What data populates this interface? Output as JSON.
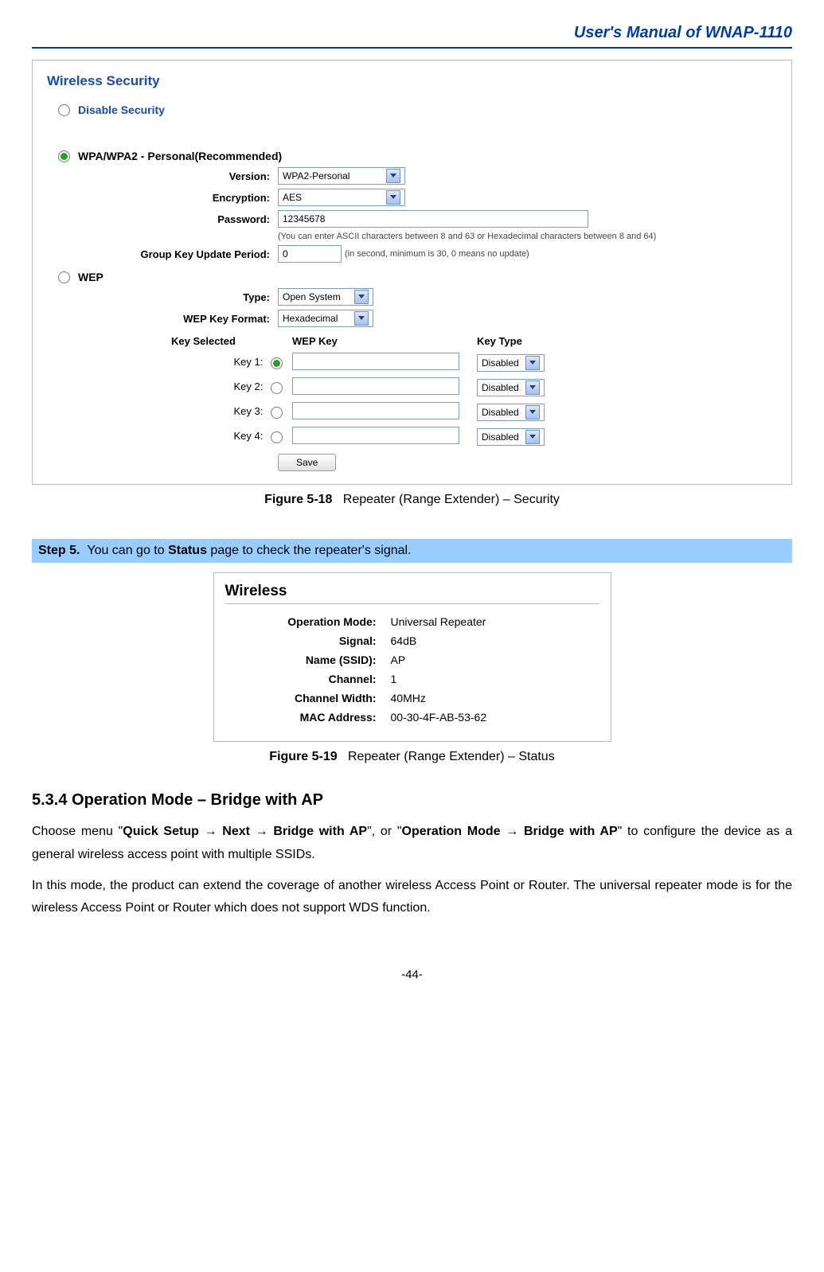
{
  "doc": {
    "header_title": "User's Manual of WNAP-1110",
    "page_number": "-44-"
  },
  "security_panel": {
    "title": "Wireless Security",
    "opt_disable": "Disable Security",
    "opt_wpa": "WPA/WPA2 - Personal(Recommended)",
    "opt_wep": "WEP",
    "version_label": "Version:",
    "version_value": "WPA2-Personal",
    "encryption_label": "Encryption:",
    "encryption_value": "AES",
    "password_label": "Password:",
    "password_value": "12345678",
    "password_hint": "(You can enter ASCII characters between 8 and 63 or Hexadecimal characters between 8 and 64)",
    "gkup_label": "Group Key Update Period:",
    "gkup_value": "0",
    "gkup_hint": "(in second, minimum is 30, 0 means no update)",
    "type_label": "Type:",
    "type_value": "Open System",
    "wep_format_label": "WEP Key Format:",
    "wep_format_value": "Hexadecimal",
    "col_key_selected": "Key Selected",
    "col_wep_key": "WEP Key",
    "col_key_type": "Key Type",
    "keys": [
      {
        "label": "Key 1:",
        "type": "Disabled"
      },
      {
        "label": "Key 2:",
        "type": "Disabled"
      },
      {
        "label": "Key 3:",
        "type": "Disabled"
      },
      {
        "label": "Key 4:",
        "type": "Disabled"
      }
    ],
    "save_label": "Save"
  },
  "captions": {
    "fig518_b": "Figure 5-18",
    "fig518_t": "Repeater (Range Extender) – Security",
    "fig519_b": "Figure 5-19",
    "fig519_t": "Repeater (Range Extender) – Status"
  },
  "step5": {
    "label_b": "Step 5.",
    "text_a": "You can go to ",
    "text_b": "Status",
    "text_c": " page to check the repeater's signal."
  },
  "status_panel": {
    "title": "Wireless",
    "rows": [
      {
        "label": "Operation Mode:",
        "value": "Universal Repeater"
      },
      {
        "label": "Signal:",
        "value": "64dB"
      },
      {
        "label": "Name (SSID):",
        "value": "AP"
      },
      {
        "label": "Channel:",
        "value": "1"
      },
      {
        "label": "Channel Width:",
        "value": "40MHz"
      },
      {
        "label": "MAC Address:",
        "value": "00-30-4F-AB-53-62"
      }
    ]
  },
  "section534": {
    "heading": "5.3.4    Operation Mode – Bridge with AP",
    "p1_a": "Choose menu \"",
    "p1_b": "Quick Setup → Next → Bridge with AP",
    "p1_c": "\", or \"",
    "p1_d": "Operation Mode → Bridge with AP",
    "p1_e": "\" to configure the device as a general wireless access point with multiple SSIDs.",
    "p2": "In this mode, the product can extend the coverage of another wireless Access Point or Router. The universal repeater mode is for the wireless Access Point or Router which does not support WDS function."
  }
}
